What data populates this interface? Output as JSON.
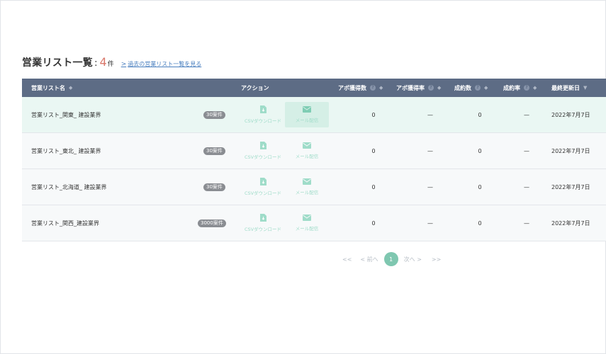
{
  "heading": {
    "title": "営業リスト一覧",
    "colon": ":",
    "count": "4",
    "unit": "件",
    "past_link_chevron": ">",
    "past_link": "過去の営業リスト一覧を見る"
  },
  "table": {
    "headers": {
      "name": "営業リスト名",
      "action": "アクション",
      "appointments": "アポ獲得数",
      "appointment_rate": "アポ獲得率",
      "contracts": "成約数",
      "contract_rate": "成約率",
      "updated": "最終更新日"
    },
    "rows": [
      {
        "name": "営業リスト_関東_ 建設業界",
        "badge": "30案件",
        "csv": "CSVダウンロード",
        "mail": "メール配信",
        "appointments": "0",
        "appointment_rate": "—",
        "contracts": "0",
        "contract_rate": "—",
        "updated": "2022年7月7日"
      },
      {
        "name": "営業リスト_東北_ 建設業界",
        "badge": "30案件",
        "csv": "CSVダウンロード",
        "mail": "メール配信",
        "appointments": "0",
        "appointment_rate": "—",
        "contracts": "0",
        "contract_rate": "—",
        "updated": "2022年7月7日"
      },
      {
        "name": "営業リスト_北海道_ 建設業界",
        "badge": "30案件",
        "csv": "CSVダウンロード",
        "mail": "メール配信",
        "appointments": "0",
        "appointment_rate": "—",
        "contracts": "0",
        "contract_rate": "—",
        "updated": "2022年7月7日"
      },
      {
        "name": "営業リスト_関西_建設業界",
        "badge": "3000案件",
        "csv": "CSVダウンロード",
        "mail": "メール配信",
        "appointments": "0",
        "appointment_rate": "—",
        "contracts": "0",
        "contract_rate": "—",
        "updated": "2022年7月7日"
      }
    ]
  },
  "pagination": {
    "first": "<<",
    "prev": "< 前へ",
    "current": "1",
    "next": "次へ >",
    "last": ">>"
  },
  "colors": {
    "header_bg": "#5d6c85",
    "accent": "#7fc7b0",
    "count": "#d9776a",
    "highlight_row": "#eaf7f3"
  },
  "icons": {
    "csv": "file-download-icon",
    "mail": "mail-icon",
    "sort": "sort-icon",
    "help": "help-icon"
  }
}
